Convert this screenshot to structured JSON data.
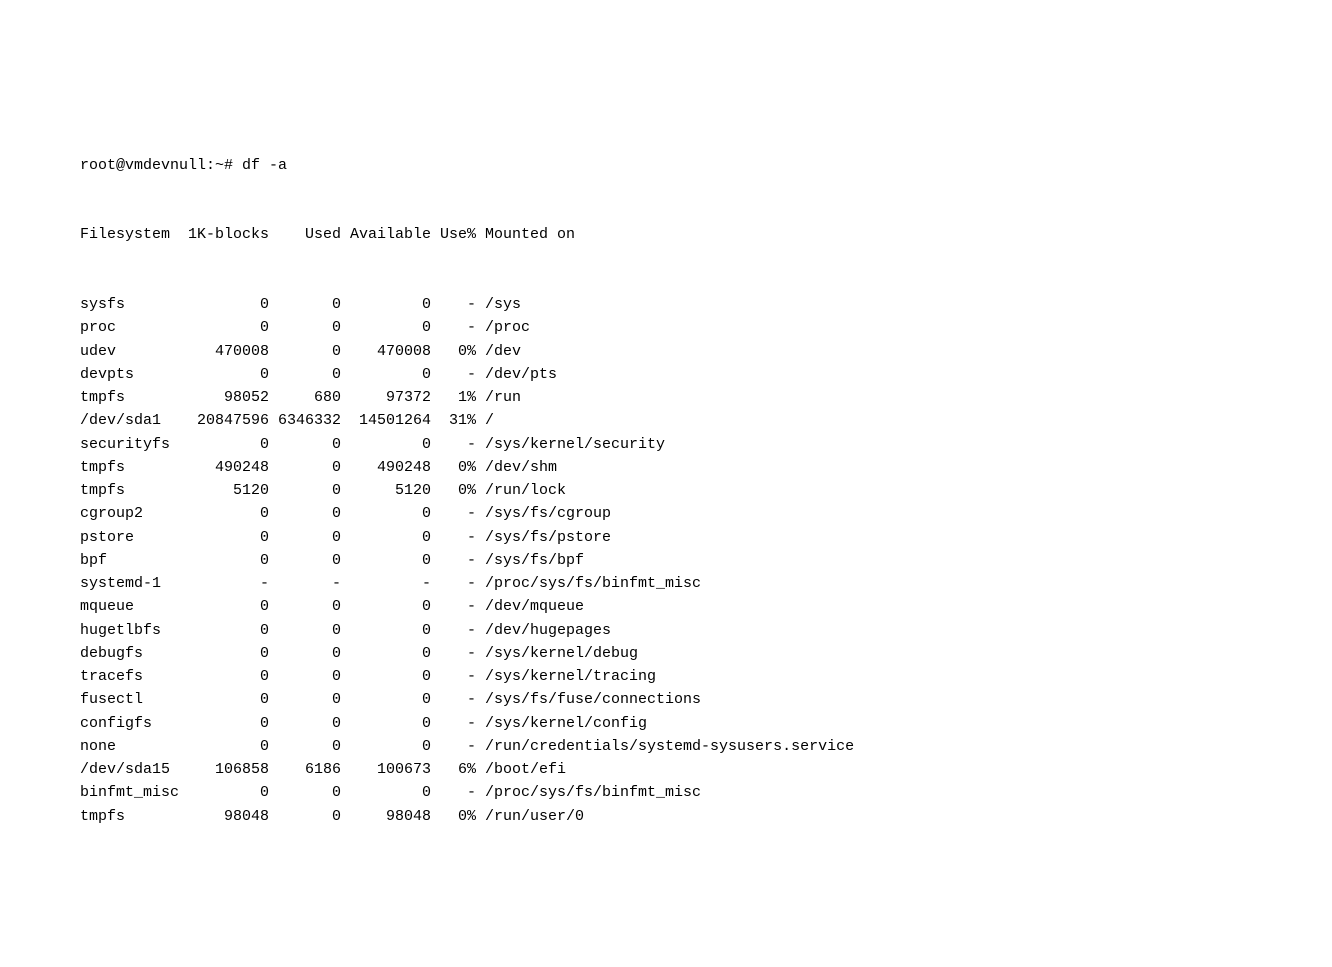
{
  "prompt": "root@vmdevnull:~# df -a",
  "headers": {
    "filesystem": "Filesystem",
    "blocks": "1K-blocks",
    "used": "Used",
    "available": "Available",
    "use_pct": "Use%",
    "mounted_on": "Mounted on"
  },
  "rows": [
    {
      "filesystem": "sysfs",
      "blocks": "0",
      "used": "0",
      "available": "0",
      "use_pct": "-",
      "mounted_on": "/sys"
    },
    {
      "filesystem": "proc",
      "blocks": "0",
      "used": "0",
      "available": "0",
      "use_pct": "-",
      "mounted_on": "/proc"
    },
    {
      "filesystem": "udev",
      "blocks": "470008",
      "used": "0",
      "available": "470008",
      "use_pct": "0%",
      "mounted_on": "/dev"
    },
    {
      "filesystem": "devpts",
      "blocks": "0",
      "used": "0",
      "available": "0",
      "use_pct": "-",
      "mounted_on": "/dev/pts"
    },
    {
      "filesystem": "tmpfs",
      "blocks": "98052",
      "used": "680",
      "available": "97372",
      "use_pct": "1%",
      "mounted_on": "/run"
    },
    {
      "filesystem": "/dev/sda1",
      "blocks": "20847596",
      "used": "6346332",
      "available": "14501264",
      "use_pct": "31%",
      "mounted_on": "/"
    },
    {
      "filesystem": "securityfs",
      "blocks": "0",
      "used": "0",
      "available": "0",
      "use_pct": "-",
      "mounted_on": "/sys/kernel/security"
    },
    {
      "filesystem": "tmpfs",
      "blocks": "490248",
      "used": "0",
      "available": "490248",
      "use_pct": "0%",
      "mounted_on": "/dev/shm"
    },
    {
      "filesystem": "tmpfs",
      "blocks": "5120",
      "used": "0",
      "available": "5120",
      "use_pct": "0%",
      "mounted_on": "/run/lock"
    },
    {
      "filesystem": "cgroup2",
      "blocks": "0",
      "used": "0",
      "available": "0",
      "use_pct": "-",
      "mounted_on": "/sys/fs/cgroup"
    },
    {
      "filesystem": "pstore",
      "blocks": "0",
      "used": "0",
      "available": "0",
      "use_pct": "-",
      "mounted_on": "/sys/fs/pstore"
    },
    {
      "filesystem": "bpf",
      "blocks": "0",
      "used": "0",
      "available": "0",
      "use_pct": "-",
      "mounted_on": "/sys/fs/bpf"
    },
    {
      "filesystem": "systemd-1",
      "blocks": "-",
      "used": "-",
      "available": "-",
      "use_pct": "-",
      "mounted_on": "/proc/sys/fs/binfmt_misc"
    },
    {
      "filesystem": "mqueue",
      "blocks": "0",
      "used": "0",
      "available": "0",
      "use_pct": "-",
      "mounted_on": "/dev/mqueue"
    },
    {
      "filesystem": "hugetlbfs",
      "blocks": "0",
      "used": "0",
      "available": "0",
      "use_pct": "-",
      "mounted_on": "/dev/hugepages"
    },
    {
      "filesystem": "debugfs",
      "blocks": "0",
      "used": "0",
      "available": "0",
      "use_pct": "-",
      "mounted_on": "/sys/kernel/debug"
    },
    {
      "filesystem": "tracefs",
      "blocks": "0",
      "used": "0",
      "available": "0",
      "use_pct": "-",
      "mounted_on": "/sys/kernel/tracing"
    },
    {
      "filesystem": "fusectl",
      "blocks": "0",
      "used": "0",
      "available": "0",
      "use_pct": "-",
      "mounted_on": "/sys/fs/fuse/connections"
    },
    {
      "filesystem": "configfs",
      "blocks": "0",
      "used": "0",
      "available": "0",
      "use_pct": "-",
      "mounted_on": "/sys/kernel/config"
    },
    {
      "filesystem": "none",
      "blocks": "0",
      "used": "0",
      "available": "0",
      "use_pct": "-",
      "mounted_on": "/run/credentials/systemd-sysusers.service"
    },
    {
      "filesystem": "/dev/sda15",
      "blocks": "106858",
      "used": "6186",
      "available": "100673",
      "use_pct": "6%",
      "mounted_on": "/boot/efi"
    },
    {
      "filesystem": "binfmt_misc",
      "blocks": "0",
      "used": "0",
      "available": "0",
      "use_pct": "-",
      "mounted_on": "/proc/sys/fs/binfmt_misc"
    },
    {
      "filesystem": "tmpfs",
      "blocks": "98048",
      "used": "0",
      "available": "98048",
      "use_pct": "0%",
      "mounted_on": "/run/user/0"
    }
  ]
}
